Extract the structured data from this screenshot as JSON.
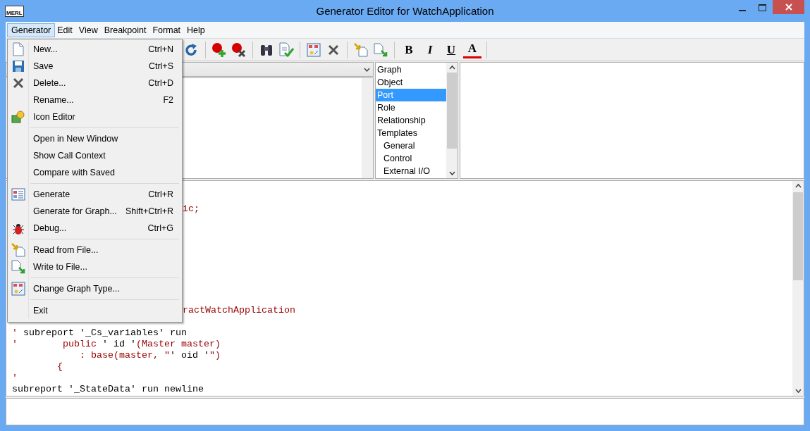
{
  "window": {
    "title": "Generator Editor for WatchApplication",
    "logo": "MERL"
  },
  "menubar": [
    {
      "label": "Generator",
      "selected": true
    },
    {
      "label": "Edit",
      "selected": false
    },
    {
      "label": "View",
      "selected": false
    },
    {
      "label": "Breakpoint",
      "selected": false
    },
    {
      "label": "Format",
      "selected": false
    },
    {
      "label": "Help",
      "selected": false
    }
  ],
  "toolbar": {
    "format_buttons": [
      {
        "label": "B",
        "kind": "bold"
      },
      {
        "label": "I",
        "kind": "italic"
      },
      {
        "label": "U",
        "kind": "underline"
      },
      {
        "label": "A",
        "kind": "color"
      }
    ]
  },
  "type_list": {
    "items": [
      {
        "label": "Graph",
        "selected": false
      },
      {
        "label": "Object",
        "selected": false
      },
      {
        "label": "Port",
        "selected": true
      },
      {
        "label": "Role",
        "selected": false
      },
      {
        "label": "Relationship",
        "selected": false
      },
      {
        "label": "Templates",
        "selected": false,
        "children": [
          {
            "label": "General",
            "selected": false
          },
          {
            "label": "Control",
            "selected": false
          },
          {
            "label": "External I/O",
            "selected": false
          }
        ]
      }
    ]
  },
  "editor": {
    "lines": [
      {
        "kind": "hidden"
      },
      {
        "kind": "hidden"
      },
      {
        "kind": "clipped",
        "segments": [
          {
            "text": "ic;",
            "kind": "literal"
          }
        ]
      },
      {
        "kind": "hidden"
      },
      {
        "kind": "hidden"
      },
      {
        "kind": "hidden"
      },
      {
        "kind": "hidden"
      },
      {
        "kind": "hidden"
      },
      {
        "kind": "hidden"
      },
      {
        "kind": "hidden"
      },
      {
        "kind": "hidden"
      },
      {
        "kind": "clipped",
        "segments": [
          {
            "text": "ractWatchApplication",
            "kind": "literal"
          }
        ]
      },
      {
        "kind": "hidden"
      },
      {
        "kind": "code",
        "segments": [
          {
            "text": "'",
            "kind": "literal"
          },
          {
            "text": " subreport '_Cs_variables' run",
            "kind": "plain"
          }
        ]
      },
      {
        "kind": "code",
        "segments": [
          {
            "text": "'",
            "kind": "literal"
          },
          {
            "text": "        public ",
            "kind": "literal"
          },
          {
            "text": "' id '",
            "kind": "plain"
          },
          {
            "text": "(Master master)",
            "kind": "literal"
          }
        ]
      },
      {
        "kind": "code",
        "segments": [
          {
            "text": "            : base(master, \"",
            "kind": "literal"
          },
          {
            "text": "' oid '",
            "kind": "plain"
          },
          {
            "text": "\")",
            "kind": "literal"
          }
        ]
      },
      {
        "kind": "code",
        "segments": [
          {
            "text": "        {",
            "kind": "literal"
          }
        ]
      },
      {
        "kind": "code",
        "segments": [
          {
            "text": "'",
            "kind": "literal"
          }
        ]
      },
      {
        "kind": "code",
        "segments": [
          {
            "text": "subreport '_StateData' run newline",
            "kind": "plain"
          }
        ]
      }
    ]
  },
  "menu": [
    {
      "kind": "item",
      "label": "New...",
      "shortcut": "Ctrl+N"
    },
    {
      "kind": "item",
      "label": "Save",
      "shortcut": "Ctrl+S"
    },
    {
      "kind": "item",
      "label": "Delete...",
      "shortcut": "Ctrl+D"
    },
    {
      "kind": "item",
      "label": "Rename...",
      "shortcut": "F2"
    },
    {
      "kind": "item",
      "label": "Icon Editor"
    },
    {
      "kind": "separator"
    },
    {
      "kind": "item",
      "label": "Open in New Window"
    },
    {
      "kind": "item",
      "label": "Show Call Context"
    },
    {
      "kind": "item",
      "label": "Compare with Saved"
    },
    {
      "kind": "separator"
    },
    {
      "kind": "item",
      "label": "Generate",
      "shortcut": "Ctrl+R"
    },
    {
      "kind": "item",
      "label": "Generate for Graph...",
      "shortcut": "Shift+Ctrl+R"
    },
    {
      "kind": "item",
      "label": "Debug...",
      "shortcut": "Ctrl+G"
    },
    {
      "kind": "separator"
    },
    {
      "kind": "item",
      "label": "Read from File..."
    },
    {
      "kind": "item",
      "label": "Write to File..."
    },
    {
      "kind": "separator"
    },
    {
      "kind": "item",
      "label": "Change Graph Type..."
    },
    {
      "kind": "separator"
    },
    {
      "kind": "item",
      "label": "Exit"
    }
  ]
}
